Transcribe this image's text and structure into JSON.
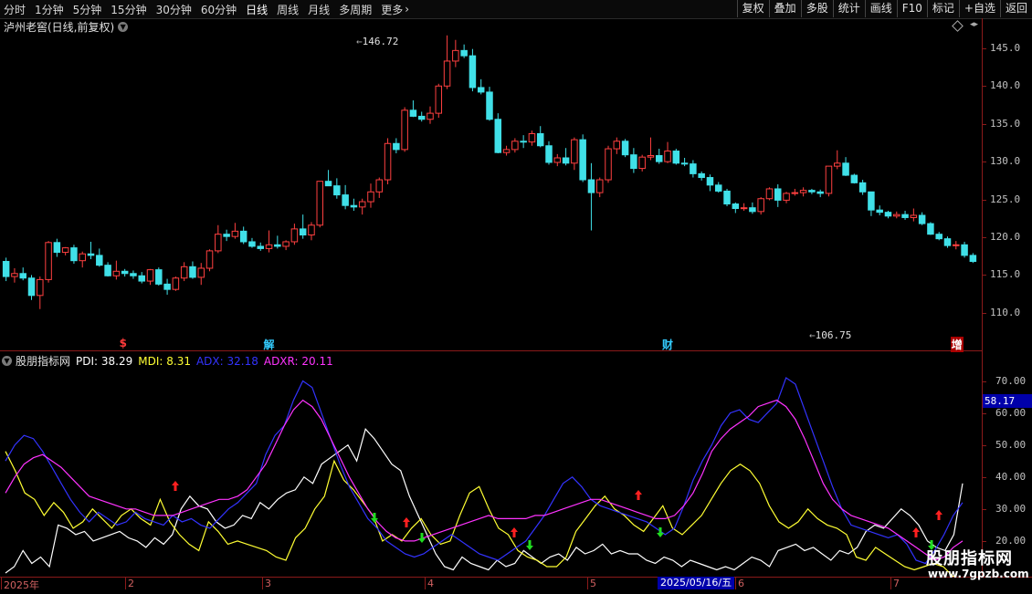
{
  "toolbar": {
    "periods": [
      "分时",
      "1分钟",
      "5分钟",
      "15分钟",
      "30分钟",
      "60分钟",
      "日线",
      "周线",
      "月线",
      "多周期",
      "更多"
    ],
    "active_period": "日线",
    "more_icon": "chevron-right-icon",
    "buttons": [
      "复权",
      "叠加",
      "多股",
      "统计",
      "画线",
      "F10",
      "标记",
      "+自选",
      "返回"
    ]
  },
  "main": {
    "title": "泸州老窖(日线,前复权)",
    "max_label": "146.72",
    "min_label": "106.75",
    "events": [
      {
        "label": "$",
        "color": "#ff3b3b",
        "idx": 14
      },
      {
        "label": "解",
        "color": "#33ccff",
        "idx": 31
      },
      {
        "label": "财",
        "color": "#33ccff",
        "idx": 78
      },
      {
        "label": "增",
        "color": "#ffffff",
        "idx": 112
      }
    ]
  },
  "indicator": {
    "name": "股朋指标网",
    "pdi_label": "PDI: 38.29",
    "mdi_label": "MDI: 8.31",
    "adx_label": "ADX: 32.18",
    "adxr_label": "ADXR: 20.11",
    "cursor_value": "58.17"
  },
  "xaxis": {
    "labels": [
      "2025年",
      "2",
      "3",
      "4",
      "5",
      "6",
      "7"
    ],
    "cursor_date": "2025/05/16/五"
  },
  "watermark": {
    "title": "股朋指标网",
    "url": "www.7gpzb.com"
  },
  "colors": {
    "up": "#ff4040",
    "down": "#40e0e8",
    "pdi": "#ffffff",
    "mdi": "#ffff33",
    "adx": "#3333ff",
    "adxr": "#ff33ff",
    "axis": "#8b1a1a"
  },
  "chart_data": [
    {
      "type": "candlestick",
      "title": "泸州老窖(日线,前复权)",
      "ylim": [
        106,
        148
      ],
      "yticks": [
        110,
        115,
        120,
        125,
        130,
        135,
        140,
        145
      ],
      "candles": [
        [
          116.8,
          117.3,
          114.2,
          114.8
        ],
        [
          114.8,
          115.9,
          114.0,
          115.2
        ],
        [
          115.2,
          116.0,
          114.3,
          114.6
        ],
        [
          114.6,
          115.0,
          111.7,
          112.3
        ],
        [
          112.3,
          114.8,
          110.5,
          114.4
        ],
        [
          114.4,
          119.5,
          114.0,
          119.3
        ],
        [
          119.3,
          119.8,
          117.4,
          118.0
        ],
        [
          118.0,
          118.7,
          117.6,
          118.6
        ],
        [
          118.6,
          119.0,
          116.5,
          116.9
        ],
        [
          116.9,
          118.1,
          116.0,
          117.8
        ],
        [
          117.8,
          119.4,
          117.1,
          117.6
        ],
        [
          117.6,
          118.5,
          116.1,
          116.3
        ],
        [
          116.3,
          116.7,
          114.8,
          114.9
        ],
        [
          114.9,
          116.9,
          114.4,
          115.5
        ],
        [
          115.5,
          115.8,
          114.8,
          115.2
        ],
        [
          115.2,
          115.6,
          114.5,
          114.9
        ],
        [
          114.9,
          115.4,
          113.9,
          114.2
        ],
        [
          114.2,
          115.8,
          113.7,
          115.7
        ],
        [
          115.7,
          116.0,
          113.6,
          113.8
        ],
        [
          113.8,
          114.5,
          112.4,
          113.1
        ],
        [
          113.1,
          114.8,
          112.9,
          114.6
        ],
        [
          114.6,
          116.7,
          114.2,
          116.1
        ],
        [
          116.1,
          116.8,
          114.5,
          114.7
        ],
        [
          114.7,
          116.6,
          113.7,
          115.9
        ],
        [
          115.9,
          118.4,
          115.5,
          118.2
        ],
        [
          118.2,
          121.6,
          117.9,
          120.4
        ],
        [
          120.4,
          121.0,
          119.5,
          120.1
        ],
        [
          120.1,
          121.9,
          119.8,
          120.8
        ],
        [
          120.8,
          121.4,
          119.1,
          119.4
        ],
        [
          119.4,
          119.9,
          118.6,
          118.8
        ],
        [
          118.8,
          119.3,
          118.2,
          118.5
        ],
        [
          118.5,
          120.9,
          118.0,
          119.0
        ],
        [
          119.0,
          120.2,
          118.5,
          118.8
        ],
        [
          118.8,
          119.6,
          118.3,
          119.4
        ],
        [
          119.4,
          121.8,
          119.0,
          121.1
        ],
        [
          121.1,
          123.0,
          119.8,
          120.3
        ],
        [
          120.3,
          122.0,
          119.6,
          121.6
        ],
        [
          121.6,
          126.9,
          121.3,
          127.4
        ],
        [
          127.4,
          128.9,
          126.8,
          126.8
        ],
        [
          126.8,
          127.8,
          125.1,
          125.6
        ],
        [
          125.6,
          126.9,
          123.7,
          124.2
        ],
        [
          124.2,
          125.1,
          123.5,
          124.0
        ],
        [
          124.0,
          125.1,
          123.0,
          124.7
        ],
        [
          124.7,
          127.1,
          123.9,
          126.0
        ],
        [
          126.0,
          127.9,
          125.2,
          127.6
        ],
        [
          127.6,
          133.1,
          127.0,
          132.4
        ],
        [
          132.4,
          133.1,
          131.1,
          131.6
        ],
        [
          131.6,
          137.2,
          131.3,
          136.8
        ],
        [
          136.8,
          138.1,
          135.9,
          136.0
        ],
        [
          136.0,
          136.6,
          135.3,
          135.6
        ],
        [
          135.6,
          137.3,
          135.0,
          136.4
        ],
        [
          136.4,
          140.3,
          135.8,
          140.0
        ],
        [
          140.0,
          146.7,
          139.6,
          143.3
        ],
        [
          143.3,
          146.1,
          142.5,
          144.7
        ],
        [
          144.7,
          145.5,
          143.7,
          144.0
        ],
        [
          144.0,
          144.9,
          139.3,
          139.8
        ],
        [
          139.8,
          140.9,
          138.9,
          139.2
        ],
        [
          139.2,
          139.9,
          135.4,
          135.6
        ],
        [
          135.6,
          136.4,
          131.1,
          131.2
        ],
        [
          131.2,
          132.1,
          130.8,
          131.6
        ],
        [
          131.6,
          133.1,
          131.2,
          132.7
        ],
        [
          132.7,
          133.5,
          131.8,
          132.6
        ],
        [
          132.6,
          134.1,
          132.1,
          133.7
        ],
        [
          133.7,
          134.7,
          131.9,
          132.1
        ],
        [
          132.1,
          132.7,
          129.6,
          129.9
        ],
        [
          129.9,
          131.0,
          129.4,
          130.5
        ],
        [
          130.5,
          131.8,
          129.5,
          129.8
        ],
        [
          129.8,
          133.2,
          128.9,
          132.9
        ],
        [
          132.9,
          133.6,
          127.3,
          127.6
        ],
        [
          127.6,
          129.8,
          120.9,
          125.9
        ],
        [
          125.9,
          127.9,
          125.3,
          127.6
        ],
        [
          127.6,
          132.1,
          127.2,
          131.7
        ],
        [
          131.7,
          133.2,
          131.0,
          132.7
        ],
        [
          132.7,
          133.0,
          130.6,
          130.9
        ],
        [
          130.9,
          131.8,
          128.5,
          129.1
        ],
        [
          129.1,
          130.9,
          128.7,
          130.6
        ],
        [
          130.6,
          133.2,
          130.2,
          130.8
        ],
        [
          130.8,
          131.7,
          129.7,
          130.0
        ],
        [
          130.0,
          132.6,
          129.8,
          131.4
        ],
        [
          131.4,
          131.7,
          129.6,
          129.8
        ],
        [
          129.8,
          130.5,
          129.4,
          129.7
        ],
        [
          129.7,
          130.2,
          127.9,
          128.4
        ],
        [
          128.4,
          128.7,
          127.5,
          127.9
        ],
        [
          127.9,
          128.3,
          126.1,
          126.9
        ],
        [
          126.9,
          127.3,
          125.9,
          126.1
        ],
        [
          126.1,
          126.4,
          124.1,
          124.4
        ],
        [
          124.4,
          124.6,
          123.2,
          123.8
        ],
        [
          123.8,
          124.5,
          123.5,
          123.9
        ],
        [
          123.9,
          124.6,
          123.1,
          123.4
        ],
        [
          123.4,
          125.3,
          123.0,
          125.1
        ],
        [
          125.1,
          126.6,
          124.9,
          126.4
        ],
        [
          126.4,
          127.0,
          124.0,
          124.9
        ],
        [
          124.9,
          126.0,
          124.5,
          125.8
        ],
        [
          125.8,
          126.4,
          125.5,
          125.9
        ],
        [
          125.9,
          126.6,
          125.4,
          126.2
        ],
        [
          126.2,
          126.4,
          125.7,
          126.0
        ],
        [
          126.0,
          126.3,
          125.3,
          125.8
        ],
        [
          125.8,
          129.4,
          125.4,
          129.4
        ],
        [
          129.4,
          131.5,
          129.0,
          129.8
        ],
        [
          129.8,
          130.6,
          128.1,
          128.2
        ],
        [
          128.2,
          128.4,
          127.1,
          127.2
        ],
        [
          127.2,
          127.6,
          125.6,
          126.0
        ],
        [
          126.0,
          124.4,
          122.8,
          123.6
        ],
        [
          123.6,
          124.2,
          122.9,
          123.3
        ],
        [
          123.3,
          123.5,
          122.5,
          122.8
        ],
        [
          122.8,
          123.4,
          122.5,
          123.0
        ],
        [
          123.0,
          123.5,
          122.3,
          122.6
        ],
        [
          122.6,
          123.8,
          122.1,
          122.9
        ],
        [
          122.9,
          123.3,
          121.6,
          121.8
        ],
        [
          121.8,
          122.0,
          120.3,
          120.4
        ],
        [
          120.4,
          120.7,
          119.6,
          119.8
        ],
        [
          119.8,
          120.1,
          118.6,
          118.9
        ],
        [
          118.9,
          119.5,
          118.4,
          119.0
        ],
        [
          119.0,
          119.4,
          117.3,
          117.6
        ],
        [
          117.6,
          117.9,
          116.6,
          116.8
        ]
      ]
    },
    {
      "type": "line",
      "title": "股朋指标网",
      "ylim": [
        10,
        75
      ],
      "yticks": [
        20,
        30,
        40,
        50,
        60,
        70
      ],
      "series": [
        {
          "name": "PDI",
          "values": [
            10,
            12,
            17,
            13,
            15,
            12,
            25,
            24,
            22,
            23,
            20,
            21,
            22,
            23,
            21,
            20,
            18,
            21,
            19,
            22,
            30,
            34,
            31,
            30,
            26,
            24,
            25,
            28,
            27,
            32,
            30,
            33,
            35,
            36,
            40,
            38,
            44,
            46,
            48,
            50,
            45,
            55,
            52,
            48,
            44,
            42,
            34,
            28,
            22,
            16,
            12,
            11,
            15,
            13,
            12,
            11,
            14,
            12,
            13,
            17,
            15,
            13,
            15,
            16,
            14,
            18,
            16,
            17,
            19,
            16,
            17,
            16,
            16,
            14,
            13,
            15,
            14,
            12,
            14,
            13,
            12,
            11,
            12,
            11,
            13,
            15,
            14,
            12,
            17,
            18,
            19,
            17,
            18,
            16,
            14,
            17,
            16,
            18,
            23,
            25,
            24,
            27,
            30,
            28,
            25,
            20,
            18,
            17,
            22,
            38
          ]
        },
        {
          "name": "MDI",
          "values": [
            48,
            42,
            35,
            33,
            28,
            32,
            29,
            24,
            26,
            30,
            27,
            24,
            28,
            30,
            27,
            25,
            33,
            26,
            22,
            19,
            17,
            26,
            23,
            19,
            20,
            19,
            18,
            17,
            15,
            14,
            21,
            24,
            30,
            34,
            45,
            39,
            36,
            32,
            28,
            20,
            22,
            20,
            24,
            27,
            22,
            19,
            20,
            28,
            35,
            37,
            30,
            24,
            22,
            17,
            15,
            14,
            12,
            12,
            15,
            23,
            27,
            31,
            34,
            30,
            28,
            25,
            23,
            27,
            31,
            24,
            22,
            25,
            28,
            33,
            38,
            42,
            44,
            42,
            38,
            31,
            26,
            24,
            26,
            30,
            27,
            25,
            24,
            22,
            15,
            14,
            18,
            16,
            14,
            12,
            11,
            12,
            13,
            12,
            9,
            8
          ]
        },
        {
          "name": "ADX",
          "values": [
            45,
            50,
            53,
            52,
            48,
            43,
            38,
            33,
            29,
            26,
            29,
            27,
            25,
            26,
            29,
            27,
            26,
            25,
            28,
            26,
            27,
            25,
            24,
            27,
            30,
            32,
            35,
            38,
            47,
            53,
            56,
            64,
            70,
            68,
            60,
            52,
            44,
            37,
            32,
            27,
            24,
            20,
            18,
            16,
            15,
            16,
            18,
            20,
            22,
            20,
            18,
            16,
            15,
            14,
            16,
            18,
            20,
            24,
            28,
            33,
            38,
            40,
            37,
            33,
            31,
            30,
            29,
            28,
            27,
            26,
            24,
            22,
            24,
            31,
            39,
            45,
            50,
            56,
            60,
            61,
            58,
            57,
            60,
            63,
            71,
            69,
            61,
            53,
            45,
            37,
            30,
            25,
            24,
            23,
            22,
            21,
            22,
            19,
            14,
            13,
            17,
            22,
            28,
            32
          ]
        },
        {
          "name": "ADXR",
          "values": [
            35,
            40,
            44,
            46,
            47,
            45,
            43,
            40,
            37,
            34,
            33,
            32,
            31,
            30,
            30,
            29,
            28,
            28,
            28,
            29,
            30,
            31,
            32,
            33,
            33,
            34,
            36,
            40,
            44,
            50,
            56,
            61,
            64,
            62,
            58,
            52,
            46,
            40,
            35,
            30,
            26,
            23,
            21,
            20,
            20,
            21,
            22,
            23,
            24,
            25,
            26,
            27,
            28,
            27,
            27,
            27,
            27,
            28,
            28,
            29,
            30,
            31,
            32,
            33,
            33,
            32,
            31,
            30,
            29,
            28,
            27,
            27,
            28,
            31,
            35,
            41,
            48,
            52,
            55,
            57,
            59,
            62,
            63,
            64,
            62,
            58,
            52,
            45,
            38,
            33,
            30,
            28,
            27,
            26,
            25,
            24,
            22,
            20,
            18,
            16,
            14,
            15,
            18,
            20
          ]
        }
      ]
    }
  ]
}
